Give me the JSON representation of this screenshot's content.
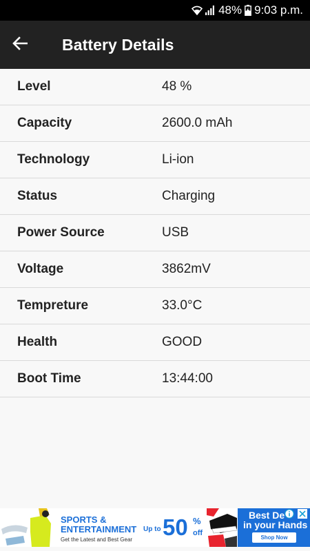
{
  "status_bar": {
    "battery_percent": "48%",
    "time": "9:03 p.m.",
    "icons": [
      "wifi-icon",
      "signal-icon",
      "battery-charging-icon"
    ]
  },
  "app_bar": {
    "title": "Battery Details",
    "back_icon": "arrow-left-icon"
  },
  "details": [
    {
      "label": "Level",
      "value": "48 %"
    },
    {
      "label": "Capacity",
      "value": "2600.0 mAh"
    },
    {
      "label": "Technology",
      "value": "Li-ion"
    },
    {
      "label": "Status",
      "value": "Charging"
    },
    {
      "label": "Power Source",
      "value": "USB"
    },
    {
      "label": "Voltage",
      "value": "3862mV"
    },
    {
      "label": "Tempreture",
      "value": "33.0°C"
    },
    {
      "label": "Health",
      "value": "GOOD"
    },
    {
      "label": "Boot Time",
      "value": "13:44:00"
    }
  ],
  "ad": {
    "headline_1": "SPORTS &",
    "headline_2": "ENTERTAINMENT",
    "subline": "Get the Latest and Best Gear",
    "up_to": "Up to",
    "discount": "50",
    "percent": "%",
    "off": "off",
    "right_line_1": "Best De",
    "right_line_2": "in your Hands",
    "shop_button": "Shop Now",
    "brand_color": "#1b6fd8"
  },
  "colors": {
    "status_bar_bg": "#000000",
    "app_bar_bg": "#222222",
    "list_bg": "#f8f8f8",
    "divider": "#d9d9d9"
  }
}
